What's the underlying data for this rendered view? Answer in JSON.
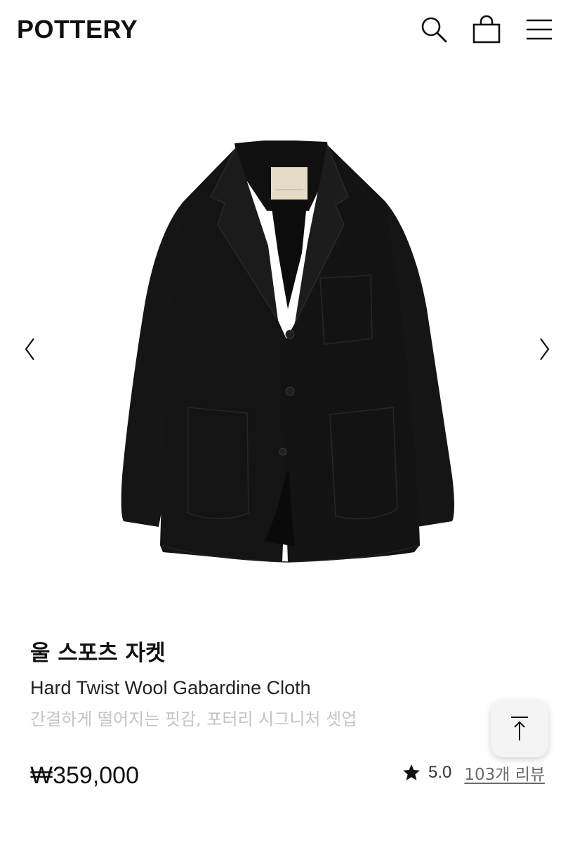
{
  "header": {
    "logo": "POTTERY",
    "icons": [
      "search-icon",
      "bag-icon",
      "menu-icon"
    ]
  },
  "gallery": {
    "image": "black-wool-sports-jacket",
    "prev_icon": "chevron-left-icon",
    "next_icon": "chevron-right-icon"
  },
  "product": {
    "title_ko": "울 스포츠 자켓",
    "title_en": "Hard Twist Wool Gabardine Cloth",
    "description": "간결하게 떨어지는 핏감, 포터리 시그니처 셋업",
    "price": "₩359,000",
    "rating": "5.0",
    "review_link": "103개 리뷰"
  },
  "colors": {
    "text": "#111111",
    "muted": "#c4c4c4",
    "jacket": "#141414",
    "label": "#e6dcc6"
  },
  "floating": {
    "top_button_icon": "arrow-up-to-top-icon"
  }
}
